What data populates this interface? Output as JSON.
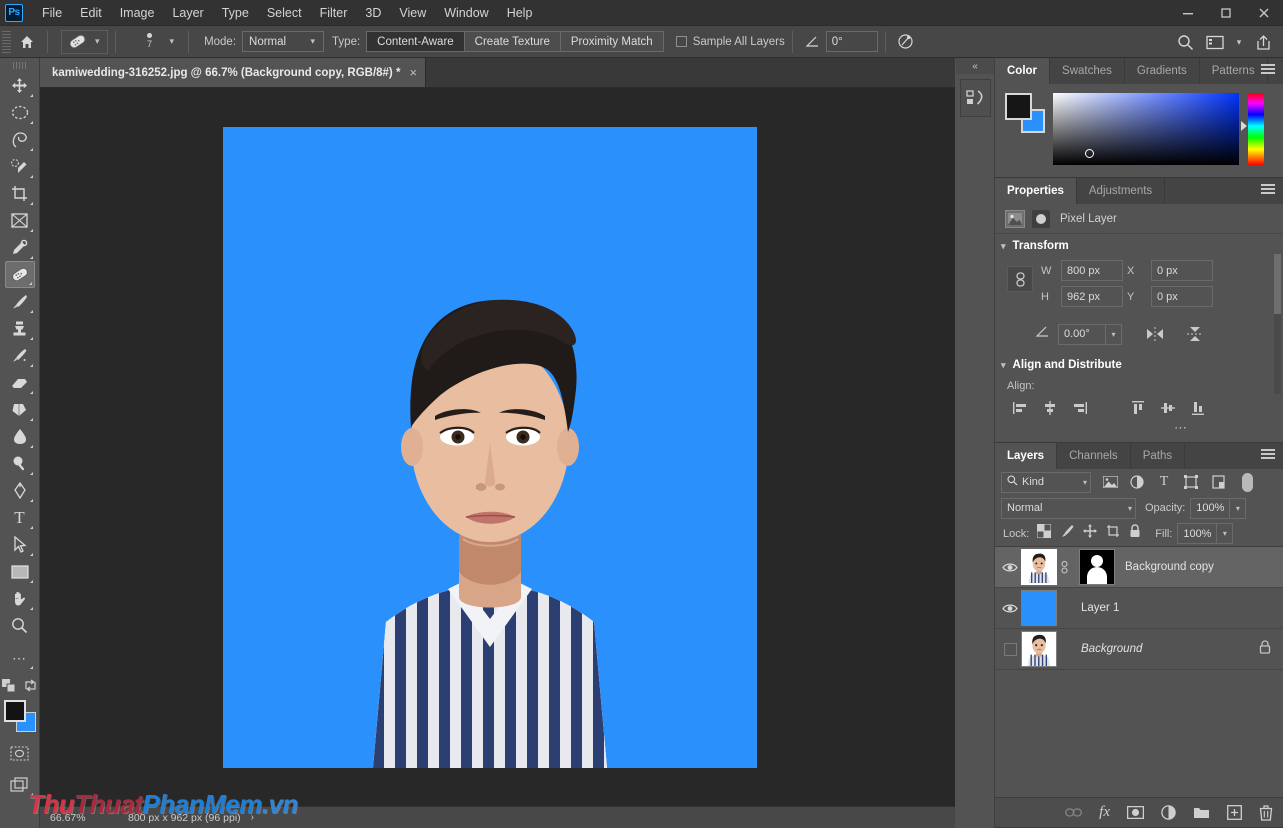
{
  "app": {
    "logo": "Ps",
    "title": "Adobe Photoshop"
  },
  "menubar": {
    "items": [
      "File",
      "Edit",
      "Image",
      "Layer",
      "Type",
      "Select",
      "Filter",
      "3D",
      "View",
      "Window",
      "Help"
    ],
    "window_controls": [
      "minimize",
      "maximize",
      "close"
    ]
  },
  "options_bar": {
    "home_icon": "home-icon",
    "tool_preset_icon": "healing-brush-icon",
    "brush_size": "7",
    "mode_label": "Mode:",
    "mode_value": "Normal",
    "type_label": "Type:",
    "type_options": [
      "Content-Aware",
      "Create Texture",
      "Proximity Match"
    ],
    "type_active": "Content-Aware",
    "sample_all_layers": "Sample All Layers",
    "sample_all_checked": false,
    "angle_icon": "angle-icon",
    "angle_value": "0°",
    "pressure_icon": "pressure-size-icon",
    "right_icons": [
      "search-icon",
      "workspace-icon",
      "chevron-down-icon",
      "share-icon"
    ]
  },
  "toolbar": {
    "tools": [
      {
        "name": "move-tool",
        "glyph": "✥",
        "active": false
      },
      {
        "name": "elliptical-marquee-tool",
        "glyph": "◯",
        "active": false
      },
      {
        "name": "lasso-tool",
        "glyph": "➿",
        "active": false
      },
      {
        "name": "quick-selection-tool",
        "glyph": "✐",
        "active": false
      },
      {
        "name": "crop-tool",
        "glyph": "⌧",
        "active": false
      },
      {
        "name": "frame-tool",
        "glyph": "⌧",
        "active": false
      },
      {
        "name": "eyedropper-tool",
        "glyph": "✒",
        "active": false
      },
      {
        "name": "healing-brush-tool",
        "glyph": "✐",
        "active": true
      },
      {
        "name": "brush-tool",
        "glyph": "✒",
        "active": false
      },
      {
        "name": "clone-stamp-tool",
        "glyph": "⚒",
        "active": false
      },
      {
        "name": "history-brush-tool",
        "glyph": "✐",
        "active": false
      },
      {
        "name": "eraser-tool",
        "glyph": "◧",
        "active": false
      },
      {
        "name": "gradient-tool",
        "glyph": "◩",
        "active": false
      },
      {
        "name": "blur-tool",
        "glyph": "●",
        "active": false
      },
      {
        "name": "dodge-tool",
        "glyph": "○",
        "active": false
      },
      {
        "name": "pen-tool",
        "glyph": "✒",
        "active": false
      },
      {
        "name": "type-tool",
        "glyph": "T",
        "active": false
      },
      {
        "name": "path-selection-tool",
        "glyph": "➤",
        "active": false
      },
      {
        "name": "rectangle-tool",
        "glyph": "▭",
        "active": false
      },
      {
        "name": "hand-tool",
        "glyph": "✋",
        "active": false
      },
      {
        "name": "zoom-tool",
        "glyph": "⌕",
        "active": false
      },
      {
        "name": "edit-toolbar-button",
        "glyph": "…",
        "active": false
      }
    ],
    "foreground_color": "#161616",
    "background_color": "#2a90fc",
    "quick_mask_icon": "quick-mask-icon",
    "screen_mode_icon": "screen-mode-icon",
    "swap_colors_icon": "swap-colors-icon",
    "default_colors_icon": "default-colors-icon"
  },
  "document": {
    "tab_title": "kamiwedding-316252.jpg @ 66.7% (Background copy, RGB/8#) *",
    "close_icon": "close-icon",
    "canvas_background": "#2a90fc"
  },
  "status_bar": {
    "zoom": "66.67%",
    "dimensions": "800 px x 962 px (96 ppi)",
    "chevron": "›"
  },
  "watermark": {
    "part1": "Thu",
    "part2": "Thuat",
    "part3": "PhanMem",
    "part4": ".vn",
    "color1": "#d63447",
    "color2": "#a8293c",
    "color3": "#1f7fd4",
    "color4": "#2f86d8"
  },
  "dock_strip": {
    "collapse_icon": "«",
    "libraries_icon": "libraries-icon"
  },
  "color_panel": {
    "tabs": [
      {
        "label": "Color",
        "active": true
      },
      {
        "label": "Swatches",
        "active": false
      },
      {
        "label": "Gradients",
        "active": false
      },
      {
        "label": "Patterns",
        "active": false
      }
    ],
    "menu_icon": "panel-menu-icon",
    "foreground": "#161616",
    "background": "#2a90fc"
  },
  "properties_panel": {
    "tabs": [
      {
        "label": "Properties",
        "active": true
      },
      {
        "label": "Adjustments",
        "active": false
      }
    ],
    "menu_icon": "panel-menu-icon",
    "layer_kind": "Pixel Layer",
    "transform": {
      "section_title": "Transform",
      "w_label": "W",
      "w_value": "800 px",
      "h_label": "H",
      "h_value": "962 px",
      "x_label": "X",
      "x_value": "0 px",
      "y_label": "Y",
      "y_value": "0 px",
      "angle_value": "0.00°",
      "link_icon": "link-aspect-ratio-icon",
      "flip_horizontal_icon": "flip-horizontal-icon",
      "flip_vertical_icon": "flip-vertical-icon"
    },
    "align": {
      "section_title": "Align and Distribute",
      "align_label": "Align:",
      "buttons": [
        "align-left-icon",
        "align-horizontal-center-icon",
        "align-right-icon",
        "align-top-icon",
        "align-vertical-center-icon",
        "align-bottom-icon"
      ],
      "more_icon": "more-options-icon"
    }
  },
  "layers_panel": {
    "tabs": [
      {
        "label": "Layers",
        "active": true
      },
      {
        "label": "Channels",
        "active": false
      },
      {
        "label": "Paths",
        "active": false
      }
    ],
    "menu_icon": "panel-menu-icon",
    "filter_kind": "Kind",
    "filter_icons": [
      "pixel-filter-icon",
      "adjustment-filter-icon",
      "type-filter-icon",
      "shape-filter-icon",
      "smart-object-filter-icon"
    ],
    "filter_toggle": "filter-enable-toggle",
    "blend_mode": "Normal",
    "opacity_label": "Opacity:",
    "opacity_value": "100%",
    "lock_label": "Lock:",
    "lock_icons": [
      "lock-transparent-pixels-icon",
      "lock-image-pixels-icon",
      "lock-position-icon",
      "lock-artboard-icon",
      "lock-all-icon"
    ],
    "fill_label": "Fill:",
    "fill_value": "100%",
    "layers": [
      {
        "name": "Background copy",
        "visible": true,
        "selected": true,
        "has_mask": true,
        "locked": false,
        "italic": false,
        "thumb": "portrait"
      },
      {
        "name": "Layer 1",
        "visible": true,
        "selected": false,
        "has_mask": false,
        "locked": false,
        "italic": false,
        "thumb": "solid-blue"
      },
      {
        "name": "Background",
        "visible": false,
        "selected": false,
        "has_mask": false,
        "locked": true,
        "italic": true,
        "thumb": "portrait"
      }
    ],
    "footer_icons": [
      "link-layers-icon",
      "layer-style-fx-icon",
      "add-layer-mask-icon",
      "new-adjustment-layer-icon",
      "new-group-icon",
      "new-layer-icon",
      "delete-layer-icon"
    ]
  }
}
